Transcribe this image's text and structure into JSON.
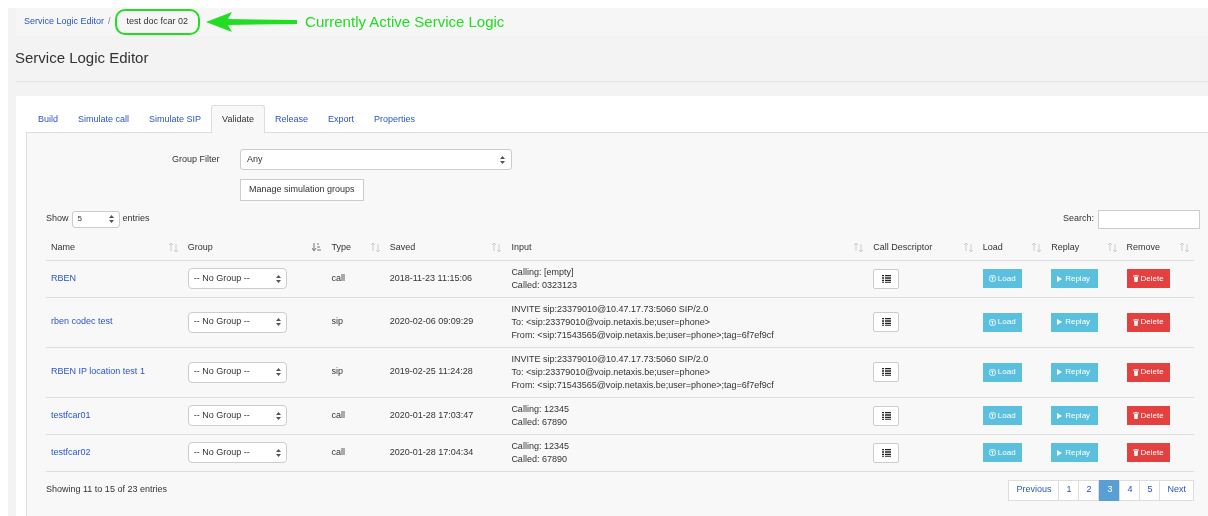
{
  "breadcrumb": [
    {
      "label": "Service Logic Editor",
      "kind": "link"
    },
    {
      "label": "test doc fcar 02",
      "kind": "current"
    }
  ],
  "breadcrumb_separator": "/",
  "annotation": {
    "text": "Currently Active Service Logic"
  },
  "page_title": "Service Logic Editor",
  "tabs": [
    {
      "label": "Build",
      "selected": false
    },
    {
      "label": "Simulate call",
      "selected": false
    },
    {
      "label": "Simulate SIP",
      "selected": false
    },
    {
      "label": "Validate",
      "selected": true
    },
    {
      "label": "Release",
      "selected": false
    },
    {
      "label": "Export",
      "selected": false
    },
    {
      "label": "Properties",
      "selected": false
    }
  ],
  "group_filter": {
    "label": "Group Filter",
    "value": "Any"
  },
  "manage_button": "Manage simulation groups",
  "length_menu": {
    "before": "Show",
    "value": "5",
    "after": "entries"
  },
  "search": {
    "label": "Search:"
  },
  "table": {
    "columns": [
      {
        "label": "Name",
        "sorted": false
      },
      {
        "label": "Group",
        "sorted": true
      },
      {
        "label": "Type",
        "sorted": false
      },
      {
        "label": "Saved",
        "sorted": false
      },
      {
        "label": "Input",
        "sorted": false
      },
      {
        "label": "Call Descriptor",
        "sorted": false
      },
      {
        "label": "Load",
        "sorted": false
      },
      {
        "label": "Replay",
        "sorted": false
      },
      {
        "label": "Remove",
        "sorted": false
      }
    ],
    "rows": [
      {
        "name": "RBEN",
        "group": "-- No Group --",
        "type": "call",
        "saved": "2018-11-23 11:15:06",
        "input": [
          "Calling: [empty]",
          "Called: 0323123"
        ],
        "load": "Load",
        "replay": "Replay",
        "remove": "Delete"
      },
      {
        "name": "rben codec test",
        "group": "-- No Group --",
        "type": "sip",
        "saved": "2020-02-06 09:09:29",
        "input": [
          "INVITE sip:23379010@10.47.17.73:5060 SIP/2.0",
          "To: <sip:23379010@voip.netaxis.be;user=phone>",
          "From: <sip:71543565@voip.netaxis.be;user=phone>;tag=6f7ef9cf"
        ],
        "load": "Load",
        "replay": "Replay",
        "remove": "Delete"
      },
      {
        "name": "RBEN IP location test 1",
        "group": "-- No Group --",
        "type": "sip",
        "saved": "2019-02-25 11:24:28",
        "input": [
          "INVITE sip:23379010@10.47.17.73:5060 SIP/2.0",
          "To: <sip:23379010@voip.netaxis.be;user=phone>",
          "From: <sip:71543565@voip.netaxis.be;user=phone>;tag=6f7ef9cf"
        ],
        "load": "Load",
        "replay": "Replay",
        "remove": "Delete"
      },
      {
        "name": "testfcar01",
        "group": "-- No Group --",
        "type": "call",
        "saved": "2020-01-28 17:03:47",
        "input": [
          "Calling: 12345",
          "Called: 67890"
        ],
        "load": "Load",
        "replay": "Replay",
        "remove": "Delete"
      },
      {
        "name": "testfcar02",
        "group": "-- No Group --",
        "type": "call",
        "saved": "2020-01-28 17:04:34",
        "input": [
          "Calling: 12345",
          "Called: 67890"
        ],
        "load": "Load",
        "replay": "Replay",
        "remove": "Delete"
      }
    ]
  },
  "info": "Showing 11 to 15 of 23 entries",
  "pagination": [
    {
      "label": "Previous",
      "selected": false
    },
    {
      "label": "1",
      "selected": false
    },
    {
      "label": "2",
      "selected": false
    },
    {
      "label": "3",
      "selected": true
    },
    {
      "label": "4",
      "selected": false
    },
    {
      "label": "5",
      "selected": false
    },
    {
      "label": "Next",
      "selected": false
    }
  ]
}
